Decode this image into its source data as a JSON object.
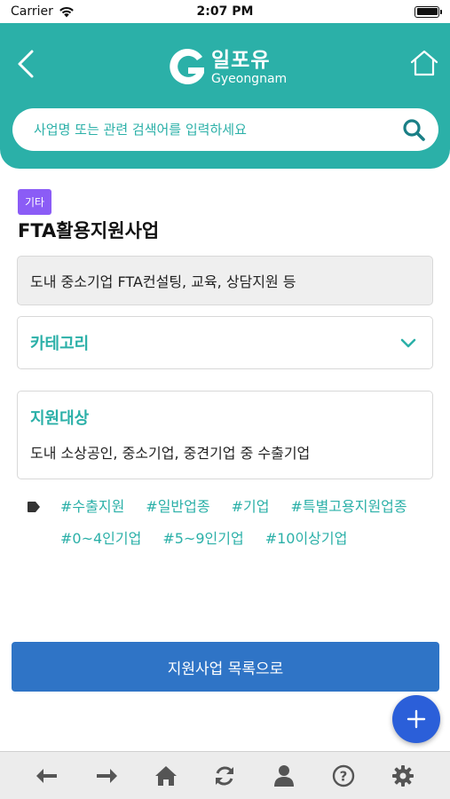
{
  "status_bar": {
    "carrier": "Carrier",
    "time": "2:07 PM"
  },
  "header": {
    "logo_main": "일포유",
    "logo_sub": "Gyeongnam"
  },
  "search": {
    "placeholder": "사업명 또는 관련 검색어를 입력하세요"
  },
  "content": {
    "badge": "기타",
    "title": "FTA활용지원사업",
    "summary": "도내 중소기업 FTA컨설팅, 교육, 상담지원 등",
    "category_label": "카테고리",
    "target_heading": "지원대상",
    "target_text": "도내 소상공인, 중소기업, 중견기업 중 수출기업",
    "tags": [
      "#수출지원",
      "#일반업종",
      "#기업",
      "#특별고용지원업종",
      "#0~4인기업",
      "#5~9인기업",
      "#10이상기업"
    ]
  },
  "actions": {
    "list_button": "지원사업 목록으로"
  },
  "colors": {
    "teal": "#2bb0a8",
    "blue_button": "#2f74c6",
    "fab": "#2b5fd9",
    "badge": "#8b5cf6"
  },
  "bottom_nav": [
    "back-icon",
    "forward-icon",
    "home-icon",
    "refresh-icon",
    "user-icon",
    "help-icon",
    "settings-icon"
  ]
}
